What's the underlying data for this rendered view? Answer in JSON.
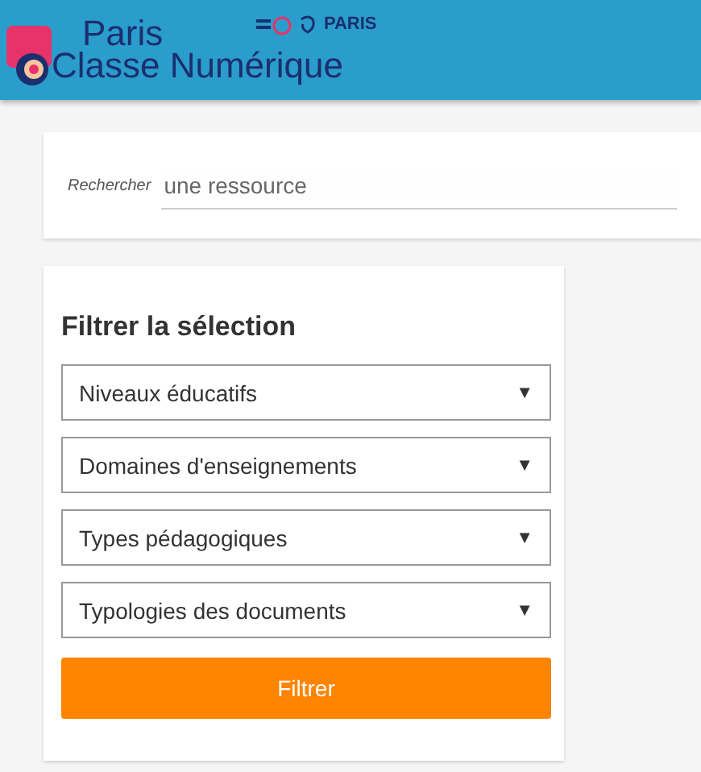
{
  "header": {
    "logo_line_1": "Paris",
    "logo_line_2": "Classe Numérique",
    "partner": "PARIS"
  },
  "search": {
    "label": "Rechercher",
    "placeholder": "une ressource"
  },
  "filter": {
    "title": "Filtrer la sélection",
    "dropdowns": [
      {
        "label": "Niveaux éducatifs",
        "caret": "▼"
      },
      {
        "label": "Domaines d'enseignements",
        "caret": "▼"
      },
      {
        "label": "Types pédagogiques",
        "caret": "▼"
      },
      {
        "label": "Typologies des documents",
        "caret": "▼"
      }
    ],
    "button": "Filtrer"
  }
}
